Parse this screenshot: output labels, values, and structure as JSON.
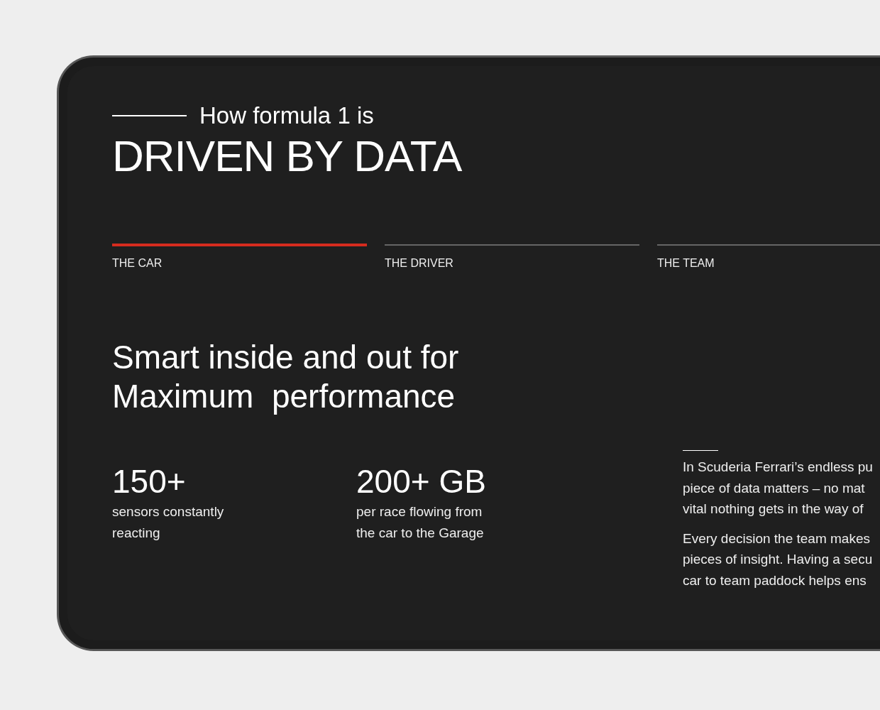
{
  "intro": {
    "lead": "How formula 1 is",
    "title": "DRIVEN BY DATA"
  },
  "tabs": [
    {
      "label": "THE CAR",
      "selected": true
    },
    {
      "label": "THE DRIVER",
      "selected": false
    },
    {
      "label": "THE TEAM",
      "selected": false
    }
  ],
  "headline": [
    "Smart inside and out for",
    "Maximum  performance"
  ],
  "stats": [
    {
      "value": "150+",
      "caption": [
        "sensors constantly",
        "reacting"
      ]
    },
    {
      "value": "200+ GB",
      "caption": [
        "per race flowing from",
        "the car to the Garage"
      ]
    }
  ],
  "paragraphs": [
    [
      "In Scuderia Ferrari’s endless pu",
      "piece of data matters – no mat",
      "vital nothing gets in the way of"
    ],
    [
      "Every decision the team makes",
      "pieces of insight. Having a secu",
      "car to team paddock helps ens"
    ]
  ]
}
